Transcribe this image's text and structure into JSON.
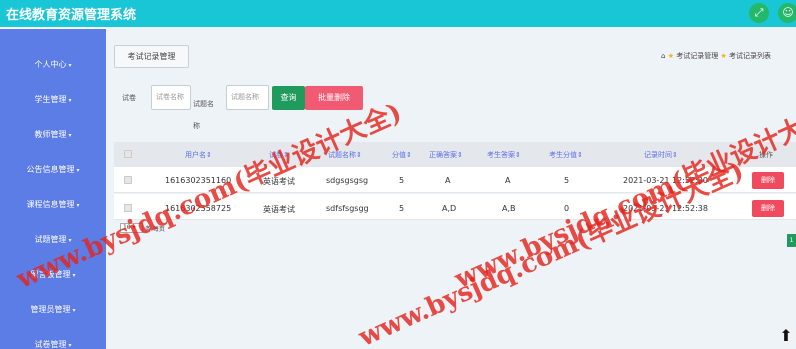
{
  "app": {
    "title": "在线教育资源管理系统"
  },
  "topbar": {
    "fullscreen_icon": "expand-icon",
    "user_icon": "user-icon"
  },
  "sidebar": {
    "items": [
      {
        "label": "个人中心"
      },
      {
        "label": "学生管理"
      },
      {
        "label": "教师管理"
      },
      {
        "label": "公告信息管理"
      },
      {
        "label": "课程信息管理"
      },
      {
        "label": "试题管理"
      },
      {
        "label": "留言板管理"
      },
      {
        "label": "管理员管理"
      },
      {
        "label": "试卷管理"
      }
    ]
  },
  "breadcrumb": {
    "current": "考试记录管理",
    "trail": [
      "考试记录管理",
      "考试记录列表"
    ]
  },
  "filters": {
    "label_paper": "试卷",
    "paper_placeholder": "试卷名称",
    "label_question": "试题名称",
    "question_placeholder": "试题名称",
    "search_label": "查询",
    "batch_delete_label": "批量删除"
  },
  "table": {
    "columns": [
      "用户名",
      "试卷",
      "试题名称",
      "分值",
      "正确答案",
      "考生答案",
      "考生分值",
      "记录时间",
      "操作"
    ],
    "rows": [
      {
        "user": "1616302351160",
        "paper": "英语考试",
        "question": "sdgsgsgsg",
        "score": "5",
        "correct": "A",
        "answer": "A",
        "got": "5",
        "time": "2021-03-21 12:52:30",
        "action": "删除"
      },
      {
        "user": "1616302358725",
        "paper": "英语考试",
        "question": "sdfsfsgsgg",
        "score": "5",
        "correct": "A,D",
        "answer": "A,B",
        "got": "0",
        "time": "2021-03-21 12:52:38",
        "action": "删除"
      }
    ]
  },
  "pager": {
    "page_size": "10",
    "per_page_label": "条 每页",
    "current_page": "1"
  },
  "watermark": {
    "text": "www.bysjdq.com(毕业设计大全)",
    "color": "#e4261d"
  }
}
